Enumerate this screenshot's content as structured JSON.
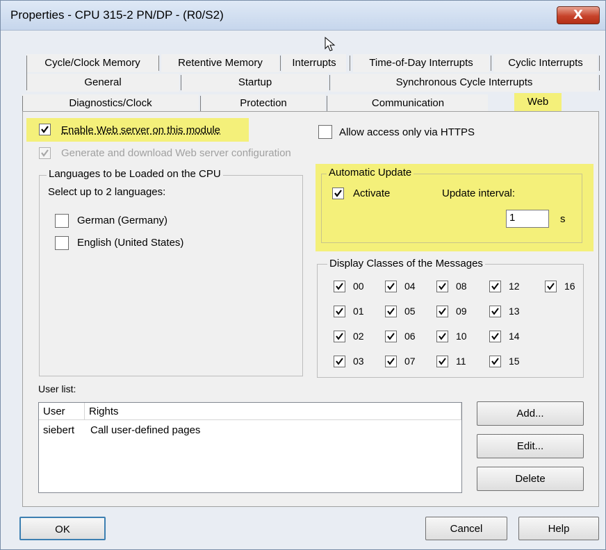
{
  "window": {
    "title": "Properties - CPU 315-2 PN/DP - (R0/S2)",
    "close_label": "X"
  },
  "tabs_row1": [
    "Cycle/Clock Memory",
    "Retentive Memory",
    "Interrupts",
    "Time-of-Day Interrupts",
    "Cyclic Interrupts"
  ],
  "tabs_row2": [
    "General",
    "Startup",
    "Synchronous Cycle Interrupts"
  ],
  "tabs_row3": [
    "Diagnostics/Clock",
    "Protection",
    "Communication",
    "Web"
  ],
  "active_tab": "Web",
  "highlight_color": "#f4f07a",
  "web": {
    "enable_web_server": {
      "label": "Enable Web server on this module",
      "checked": true
    },
    "generate_config": {
      "label": "Generate and download Web server configuration",
      "checked": true,
      "disabled": true
    },
    "https_only": {
      "label": "Allow access only via HTTPS",
      "checked": false
    }
  },
  "languages": {
    "legend": "Languages to be Loaded on the CPU",
    "hint": "Select up to 2 languages:",
    "items": [
      {
        "label": "German (Germany)",
        "checked": false
      },
      {
        "label": "English (United States)",
        "checked": false
      }
    ]
  },
  "auto_update": {
    "legend": "Automatic Update",
    "activate_label": "Activate",
    "activate_checked": true,
    "interval_label": "Update interval:",
    "interval_value": "1",
    "unit": "s"
  },
  "message_classes": {
    "legend": "Display Classes of the Messages",
    "columns": [
      [
        "00",
        "01",
        "02",
        "03"
      ],
      [
        "04",
        "05",
        "06",
        "07"
      ],
      [
        "08",
        "09",
        "10",
        "11"
      ],
      [
        "12",
        "13",
        "14",
        "15"
      ],
      [
        "16"
      ]
    ]
  },
  "user_list": {
    "label": "User list:",
    "columns": [
      "User",
      "Rights"
    ],
    "rows": [
      {
        "user": "siebert",
        "rights": "Call user-defined pages"
      }
    ]
  },
  "buttons": {
    "add": "Add...",
    "edit": "Edit...",
    "delete": "Delete",
    "ok": "OK",
    "cancel": "Cancel",
    "help": "Help"
  }
}
